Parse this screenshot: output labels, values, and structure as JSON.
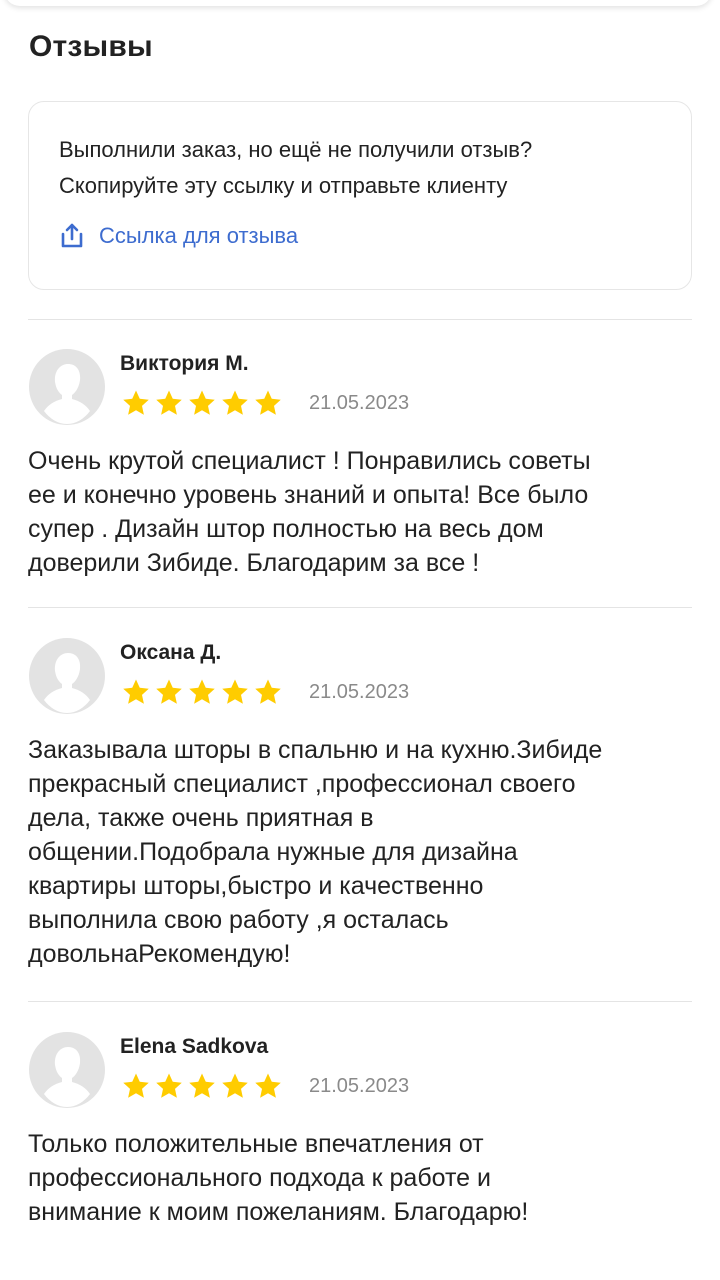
{
  "section": {
    "title": "Отзывы"
  },
  "info": {
    "line1": "Выполнили заказ, но ещё не получили отзыв?",
    "line2": "Скопируйте эту ссылку и отправьте клиенту",
    "link_label": "Ссылка для отзыва",
    "link_icon": "share-icon"
  },
  "colors": {
    "accent": "#3d6ccf",
    "star": "#ffcc00",
    "divider": "#e4e4e4"
  },
  "reviews": [
    {
      "author": "Виктория М.",
      "rating": 5,
      "date": "21.05.2023",
      "lines": [
        "Очень крутой специалист ! Понравились советы",
        "ее и конечно уровень знаний и опыта! Все было",
        "супер . Дизайн штор полностью на весь дом",
        "доверили Зибиде. Благодарим за все !"
      ]
    },
    {
      "author": "Оксана Д.",
      "rating": 5,
      "date": "21.05.2023",
      "lines": [
        "Заказывала шторы в спальню и на кухню.Зибиде",
        "прекрасный специалист ,профессионал своего",
        "дела, также очень приятная в",
        "общении.Подобрала нужные для дизайна",
        "квартиры шторы,быстро и качественно",
        "выполнила свою работу ,я осталась",
        "довольнаРекомендую!"
      ]
    },
    {
      "author": "Elena Sadkova",
      "rating": 5,
      "date": "21.05.2023",
      "lines": [
        "Только положительные впечатления от",
        "профессионального подхода к работе и",
        "внимание к моим пожеланиям. Благодарю!"
      ]
    }
  ]
}
